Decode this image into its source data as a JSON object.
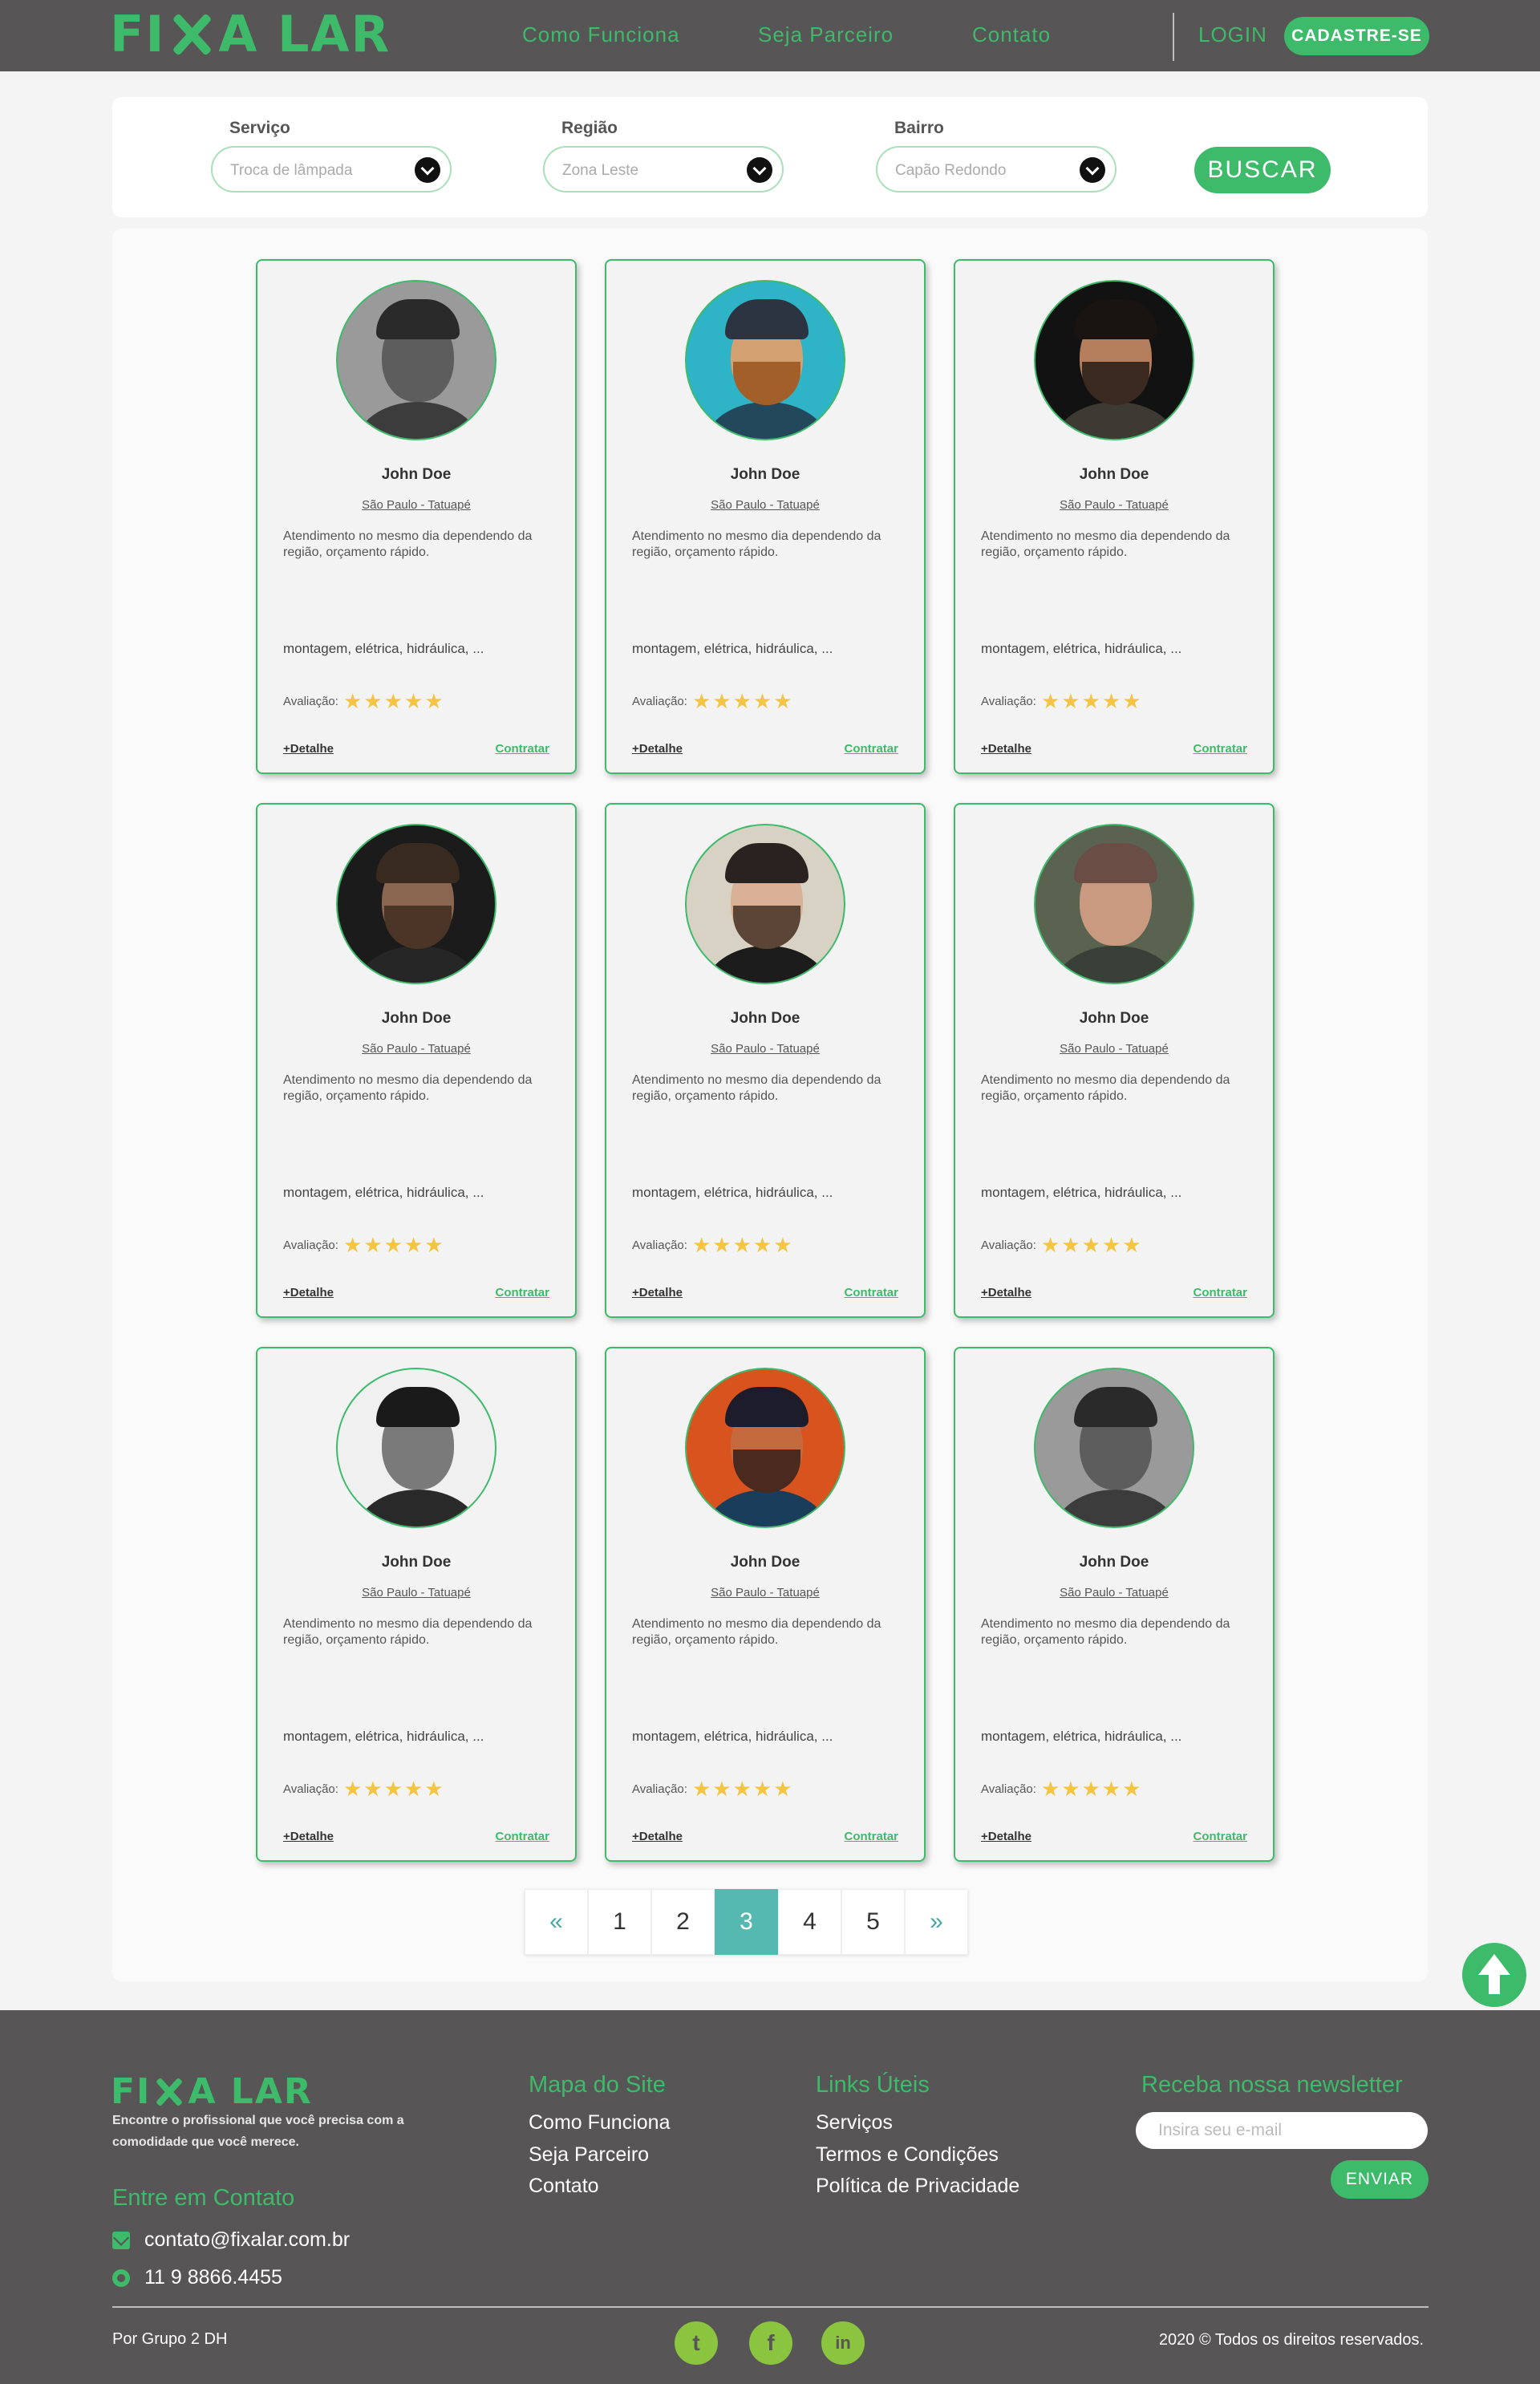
{
  "header": {
    "logo_left": "FI",
    "logo_right": "A LAR",
    "nav": [
      "Como Funciona",
      "Seja Parceiro",
      "Contato"
    ],
    "login": "LOGIN",
    "signup": "CADASTRE-SE"
  },
  "search": {
    "service_label": "Serviço",
    "service_value": "Troca de lâmpada",
    "region_label": "Região",
    "region_value": "Zona Leste",
    "district_label": "Bairro",
    "district_value": "Capão Redondo",
    "button": "BUSCAR"
  },
  "cards": [
    {
      "name": "John Doe",
      "location": "São Paulo - Tatuapé",
      "description": "Atendimento no mesmo dia dependendo da região, orçamento rápido.",
      "skills": "montagem, elétrica, hidráulica, ...",
      "rating_label": "Avaliação:",
      "stars": 5,
      "detail": "+Detalhe",
      "hire": "Contratar",
      "photo": {
        "bg": "#9a9a9a",
        "skin": "#5d5d5d",
        "hair": "#2a2a2a",
        "body": "#3c3c3c",
        "beard": ""
      }
    },
    {
      "name": "John Doe",
      "location": "São Paulo - Tatuapé",
      "description": "Atendimento no mesmo dia dependendo da região, orçamento rápido.",
      "skills": "montagem, elétrica, hidráulica, ...",
      "rating_label": "Avaliação:",
      "stars": 5,
      "detail": "+Detalhe",
      "hire": "Contratar",
      "photo": {
        "bg": "#2eb3c7",
        "skin": "#d3a071",
        "hair": "#2b3440",
        "body": "#23475b",
        "beard": "#a25f2a"
      }
    },
    {
      "name": "John Doe",
      "location": "São Paulo - Tatuapé",
      "description": "Atendimento no mesmo dia dependendo da região, orçamento rápido.",
      "skills": "montagem, elétrica, hidráulica, ...",
      "rating_label": "Avaliação:",
      "stars": 5,
      "detail": "+Detalhe",
      "hire": "Contratar",
      "photo": {
        "bg": "#121212",
        "skin": "#b57f5e",
        "hair": "#1a1410",
        "body": "#3c3a32",
        "beard": "#3b2a20"
      }
    },
    {
      "name": "John Doe",
      "location": "São Paulo - Tatuapé",
      "description": "Atendimento no mesmo dia dependendo da região, orçamento rápido.",
      "skills": "montagem, elétrica, hidráulica, ...",
      "rating_label": "Avaliação:",
      "stars": 5,
      "detail": "+Detalhe",
      "hire": "Contratar",
      "photo": {
        "bg": "#1b1b1b",
        "skin": "#8a6550",
        "hair": "#3a2b20",
        "body": "#262626",
        "beard": "#4a3526"
      }
    },
    {
      "name": "John Doe",
      "location": "São Paulo - Tatuapé",
      "description": "Atendimento no mesmo dia dependendo da região, orçamento rápido.",
      "skills": "montagem, elétrica, hidráulica, ...",
      "rating_label": "Avaliação:",
      "stars": 5,
      "detail": "+Detalhe",
      "hire": "Contratar",
      "photo": {
        "bg": "#d7d2c4",
        "skin": "#d8b096",
        "hair": "#2a2220",
        "body": "#1c1c1c",
        "beard": "#5a4536"
      }
    },
    {
      "name": "John Doe",
      "location": "São Paulo - Tatuapé",
      "description": "Atendimento no mesmo dia dependendo da região, orçamento rápido.",
      "skills": "montagem, elétrica, hidráulica, ...",
      "rating_label": "Avaliação:",
      "stars": 5,
      "detail": "+Detalhe",
      "hire": "Contratar",
      "photo": {
        "bg": "#5a6250",
        "skin": "#c99a80",
        "hair": "#6a4d44",
        "body": "#394038",
        "beard": ""
      }
    },
    {
      "name": "John Doe",
      "location": "São Paulo - Tatuapé",
      "description": "Atendimento no mesmo dia dependendo da região, orçamento rápido.",
      "skills": "montagem, elétrica, hidráulica, ...",
      "rating_label": "Avaliação:",
      "stars": 5,
      "detail": "+Detalhe",
      "hire": "Contratar",
      "photo": {
        "bg": "#f0f0f0",
        "skin": "#7a7a7a",
        "hair": "#1a1a1a",
        "body": "#2a2a2a",
        "beard": ""
      }
    },
    {
      "name": "John Doe",
      "location": "São Paulo - Tatuapé",
      "description": "Atendimento no mesmo dia dependendo da região, orçamento rápido.",
      "skills": "montagem, elétrica, hidráulica, ...",
      "rating_label": "Avaliação:",
      "stars": 5,
      "detail": "+Detalhe",
      "hire": "Contratar",
      "photo": {
        "bg": "#d9531e",
        "skin": "#c46a3e",
        "hair": "#1c1c2a",
        "body": "#1a3d5c",
        "beard": "#4a2a1e"
      }
    },
    {
      "name": "John Doe",
      "location": "São Paulo - Tatuapé",
      "description": "Atendimento no mesmo dia dependendo da região, orçamento rápido.",
      "skills": "montagem, elétrica, hidráulica, ...",
      "rating_label": "Avaliação:",
      "stars": 5,
      "detail": "+Detalhe",
      "hire": "Contratar",
      "photo": {
        "bg": "#9a9a9a",
        "skin": "#5d5d5d",
        "hair": "#2a2a2a",
        "body": "#3c3c3c",
        "beard": ""
      }
    }
  ],
  "pagination": {
    "prev": "«",
    "pages": [
      "1",
      "2",
      "3",
      "4",
      "5"
    ],
    "current": "3",
    "next": "»"
  },
  "footer": {
    "tagline": "Encontre o profissional que você precisa com a comodidade que você merece.",
    "contact_heading": "Entre em Contato",
    "email": "contato@fixalar.com.br",
    "phone": "11 9 8866.4455",
    "sitemap_heading": "Mapa do Site",
    "sitemap_links": [
      "Como Funciona",
      "Seja Parceiro",
      "Contato"
    ],
    "useful_heading": "Links Úteis",
    "useful_links": [
      "Serviços",
      "Termos e Condições",
      "Política de Privacidade"
    ],
    "newsletter_heading": "Receba nossa newsletter",
    "newsletter_placeholder": "Insira seu e-mail",
    "send": "ENVIAR",
    "credit": "Por Grupo 2 DH",
    "copyright": "2020 © Todos os direitos reservados.",
    "social": [
      "twitter-icon",
      "facebook-icon",
      "linkedin-icon"
    ]
  },
  "colors": {
    "brand_green": "#3dba6a",
    "header_bg": "#575555",
    "pagination_active": "#55b9b1",
    "star": "#f4c542"
  }
}
